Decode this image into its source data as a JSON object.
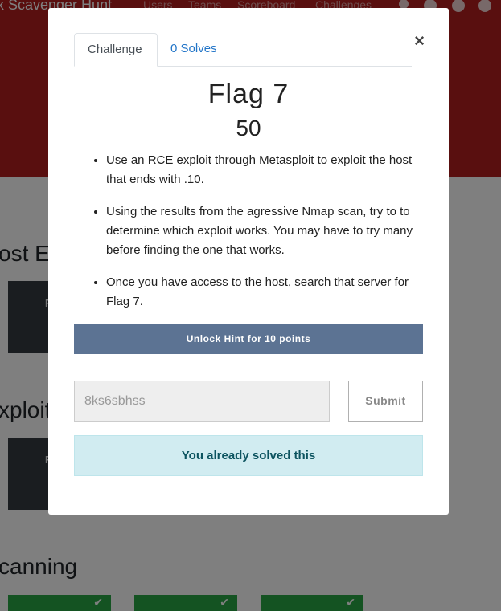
{
  "background": {
    "brand": "x Scavenger Hunt",
    "nav": [
      "Users",
      "Teams",
      "Scoreboard",
      "Challenges"
    ],
    "categories": [
      "ost Ex",
      "xploit",
      "canning"
    ],
    "tile_labels": [
      "Fl",
      "F"
    ],
    "check_icon": "✔",
    "colors": {
      "header": "#b21e1e",
      "solved": "#28a745",
      "tile": "#343a40"
    }
  },
  "modal": {
    "close_label": "×",
    "tabs": [
      {
        "label": "Challenge"
      },
      {
        "label": "0 Solves"
      }
    ],
    "challenge": {
      "name": "Flag 7",
      "value": "50",
      "description": [
        "Use an RCE exploit through Metasploit to exploit the host that ends with .10.",
        "Using the results from the agressive Nmap scan, try to to determine which exploit works. You may have to try many before finding the one that works.",
        "Once you have access to the host, search that server for Flag 7."
      ]
    },
    "hint_button": "Unlock Hint for 10 points",
    "answer_value": "8ks6sbhss",
    "submit_label": "Submit",
    "solved_message": "You already solved this",
    "colors": {
      "hint": "#5c7393",
      "alert_bg": "#d1ecf1",
      "alert_text": "#0c5460",
      "tab_link": "#2275c8"
    }
  }
}
